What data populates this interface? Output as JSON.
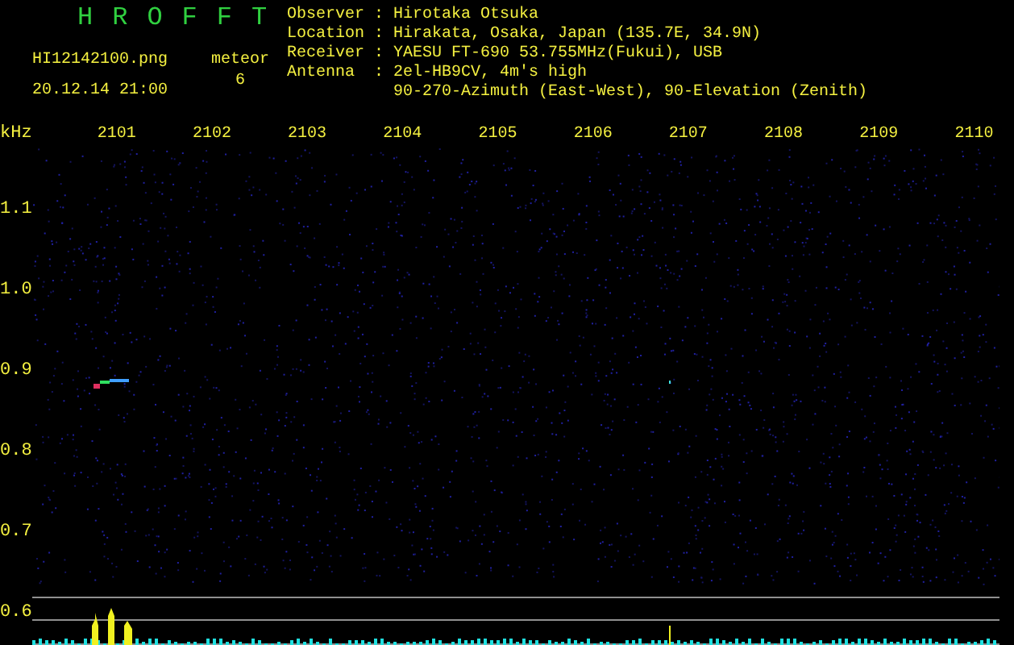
{
  "title": "HROFFT",
  "file_name": "HI12142100.png",
  "date_time": "20.12.14 21:00",
  "meteor": {
    "label": "meteor",
    "count": "6"
  },
  "info": [
    {
      "label": "Observer",
      "separator": ":",
      "value": "Hirotaka Otsuka"
    },
    {
      "label": "Location",
      "separator": ":",
      "value": "Hirakata, Osaka, Japan (135.7E, 34.9N)"
    },
    {
      "label": "Receiver",
      "separator": ":",
      "value": "YAESU FT-690 53.755MHz(Fukui), USB"
    },
    {
      "label": "Antenna",
      "separator": ":",
      "value": "2el-HB9CV, 4m's high"
    },
    {
      "value": "90-270-Azimuth (East-West), 90-Elevation (Zenith)"
    }
  ],
  "y_unit": "kHz",
  "x_ticks": [
    "2101",
    "2102",
    "2103",
    "2104",
    "2105",
    "2106",
    "2107",
    "2108",
    "2109",
    "2110"
  ],
  "y_ticks": [
    "1.1",
    "1.0",
    "0.9",
    "0.8",
    "0.7",
    "0.6"
  ]
}
